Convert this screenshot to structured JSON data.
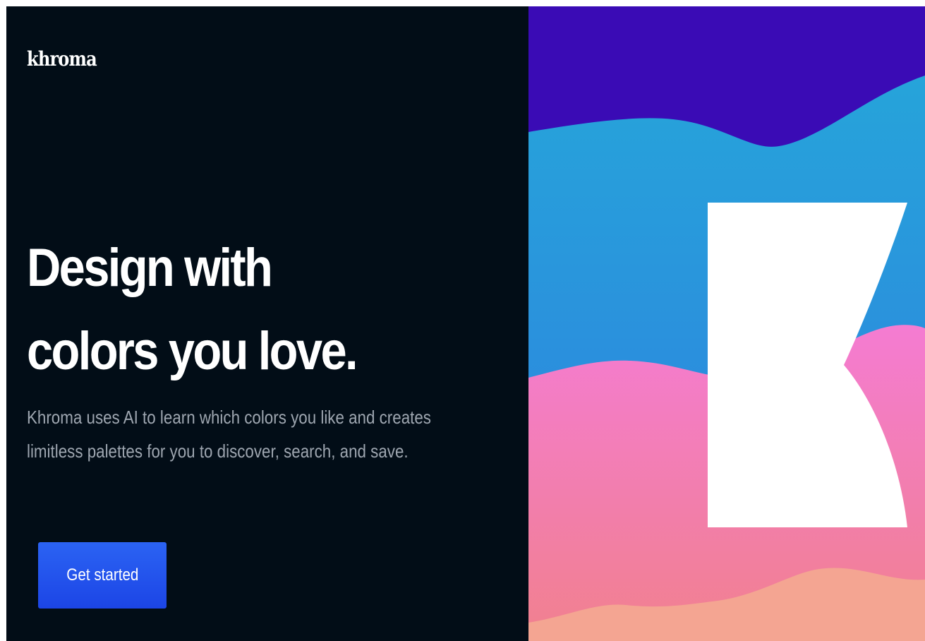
{
  "brand": {
    "logo_text": "khroma"
  },
  "hero": {
    "headline_line1": "Design with",
    "headline_line2": "colors you love.",
    "description_line1": "Khroma uses AI to learn which colors you like and creates",
    "description_line2": "limitless palettes for you to discover, search, and save.",
    "cta_label": "Get started"
  },
  "colors": {
    "background": "#020d17",
    "headline": "#ffffff",
    "description": "#9ea6b0",
    "cta_top": "#2b63f3",
    "cta_bottom": "#1c45e6",
    "wave_purple": "#3a0bb5",
    "wave_blue_top": "#26a4da",
    "wave_blue_bottom": "#2f7ce0",
    "wave_pink_top": "#f47cd2",
    "wave_pink_bottom": "#f1808e",
    "wave_peach": "#f4a592",
    "logo_mark": "#ffffff"
  },
  "icons": {
    "hero_art": "khroma-k-logo-mark"
  }
}
